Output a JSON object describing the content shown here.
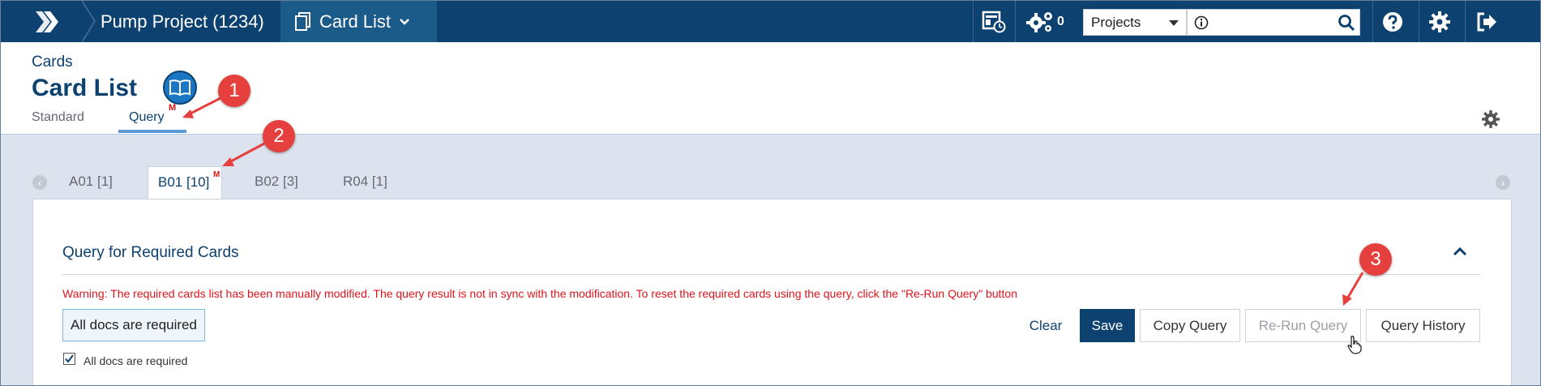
{
  "topbar": {
    "project_crumb": "Pump Project (1234)",
    "list_crumb": "Card List",
    "notifications_count": "0",
    "search_scope": "Projects",
    "search_placeholder": ""
  },
  "header": {
    "section_label": "Cards",
    "page_title": "Card List",
    "book_badge": "M",
    "view_tabs": [
      {
        "label": "Standard",
        "active": false
      },
      {
        "label": "Query",
        "active": true
      }
    ]
  },
  "callouts": [
    "1",
    "2",
    "3"
  ],
  "doc_tabs": [
    {
      "label": "A01 [1]",
      "active": false
    },
    {
      "label": "B01 [10]",
      "active": true,
      "badge": "M"
    },
    {
      "label": "B02 [3]",
      "active": false
    },
    {
      "label": "R04 [1]",
      "active": false
    }
  ],
  "panel": {
    "title": "Query for Required Cards",
    "warning": "Warning: The required cards list has been manually modified. The query result is not in sync with the modification. To reset the required cards using the query, click the \"Re-Run Query\" button",
    "query_tag": "All docs are required",
    "buttons": {
      "clear": "Clear",
      "save": "Save",
      "copy": "Copy Query",
      "rerun": "Re-Run Query",
      "history": "Query History"
    },
    "checkbox_label": "All docs are required",
    "checkbox_checked": true
  },
  "colors": {
    "brand": "#0d4170",
    "accent": "#1b76c4",
    "warning": "#e0141c",
    "callout": "#e5403d"
  }
}
